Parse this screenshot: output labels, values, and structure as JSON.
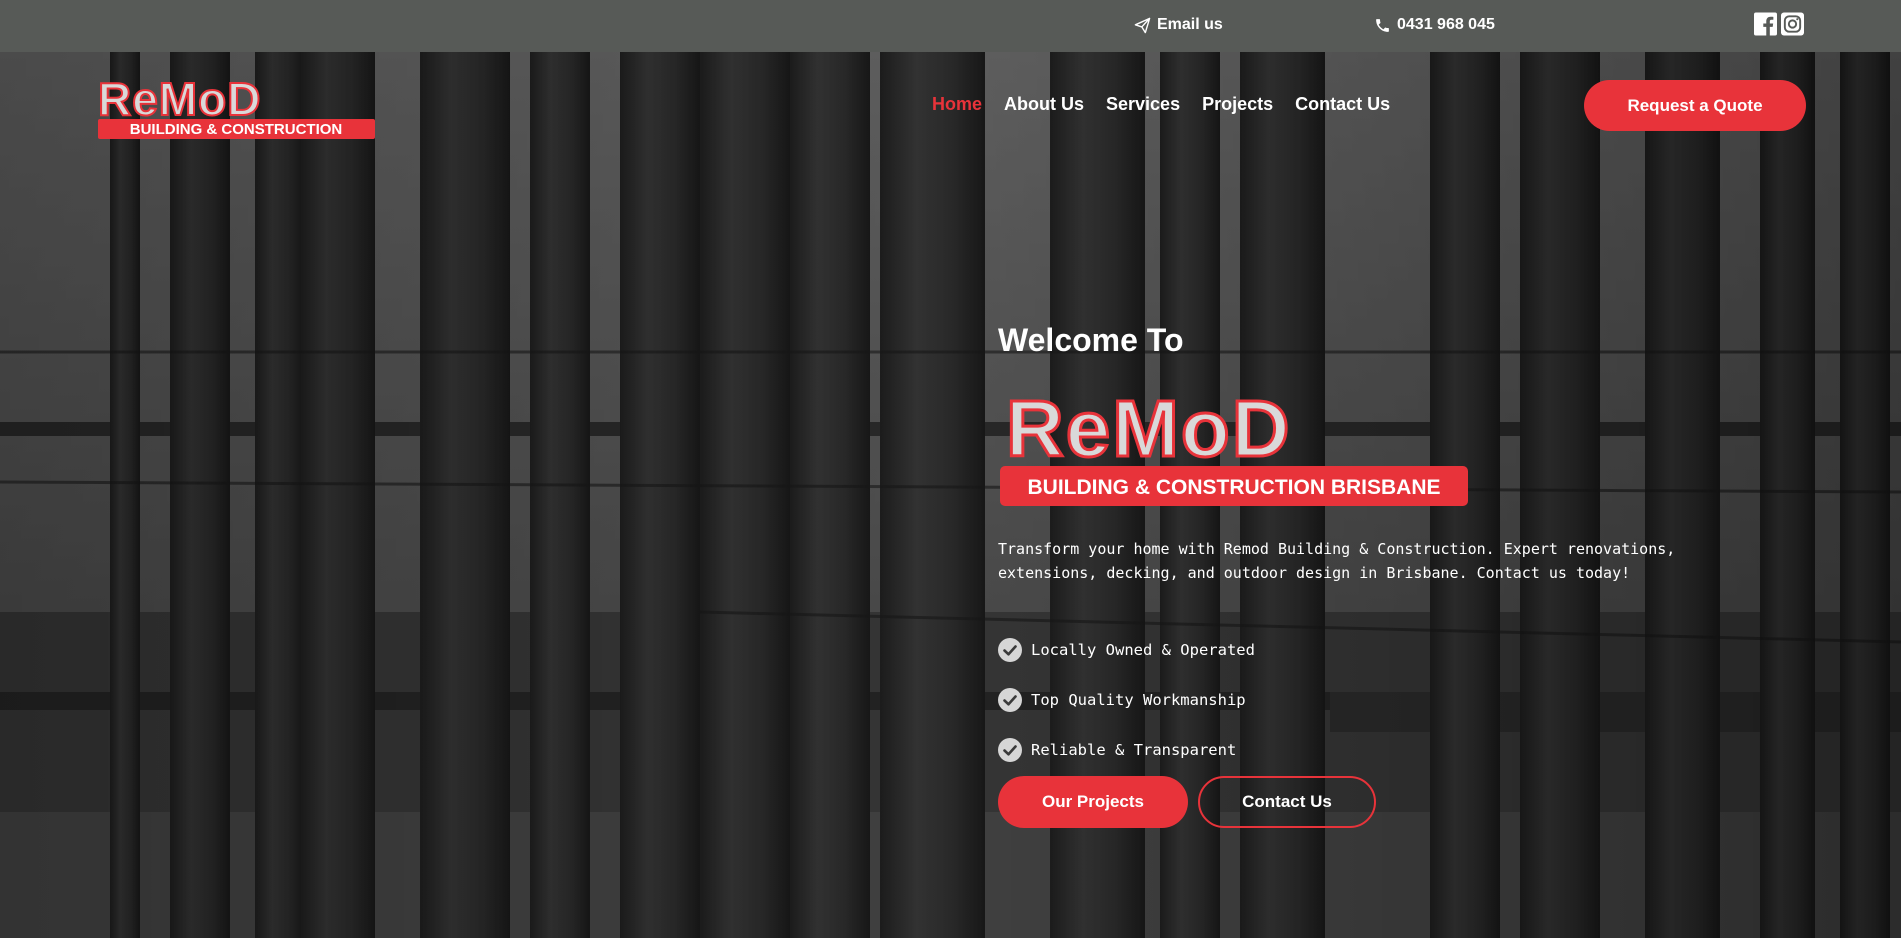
{
  "topbar": {
    "email_label": "Email us",
    "phone_label": "0431 968 045",
    "social_icons": [
      "facebook-icon",
      "instagram-icon"
    ],
    "background_color": "#575a57"
  },
  "logo": {
    "brand": "ReMoD",
    "tagline_small": "BUILDING & CONSTRUCTION",
    "tagline_large": "BUILDING & CONSTRUCTION BRISBANE"
  },
  "nav": {
    "items": [
      {
        "label": "Home",
        "active": true
      },
      {
        "label": "About Us",
        "active": false
      },
      {
        "label": "Services",
        "active": false
      },
      {
        "label": "Projects",
        "active": false
      },
      {
        "label": "Contact Us",
        "active": false
      }
    ],
    "cta_label": "Request a Quote"
  },
  "hero": {
    "welcome": "Welcome To",
    "description": "Transform your home with Remod Building & Construction. Expert renovations, extensions, decking, and outdoor design in Brisbane. Contact us today!",
    "features": [
      "Locally Owned & Operated",
      "Top Quality Workmanship",
      "Reliable & Transparent"
    ],
    "primary_button": "Our Projects",
    "secondary_button": "Contact Us"
  },
  "colors": {
    "accent": "#e8333a",
    "text": "#ffffff"
  }
}
